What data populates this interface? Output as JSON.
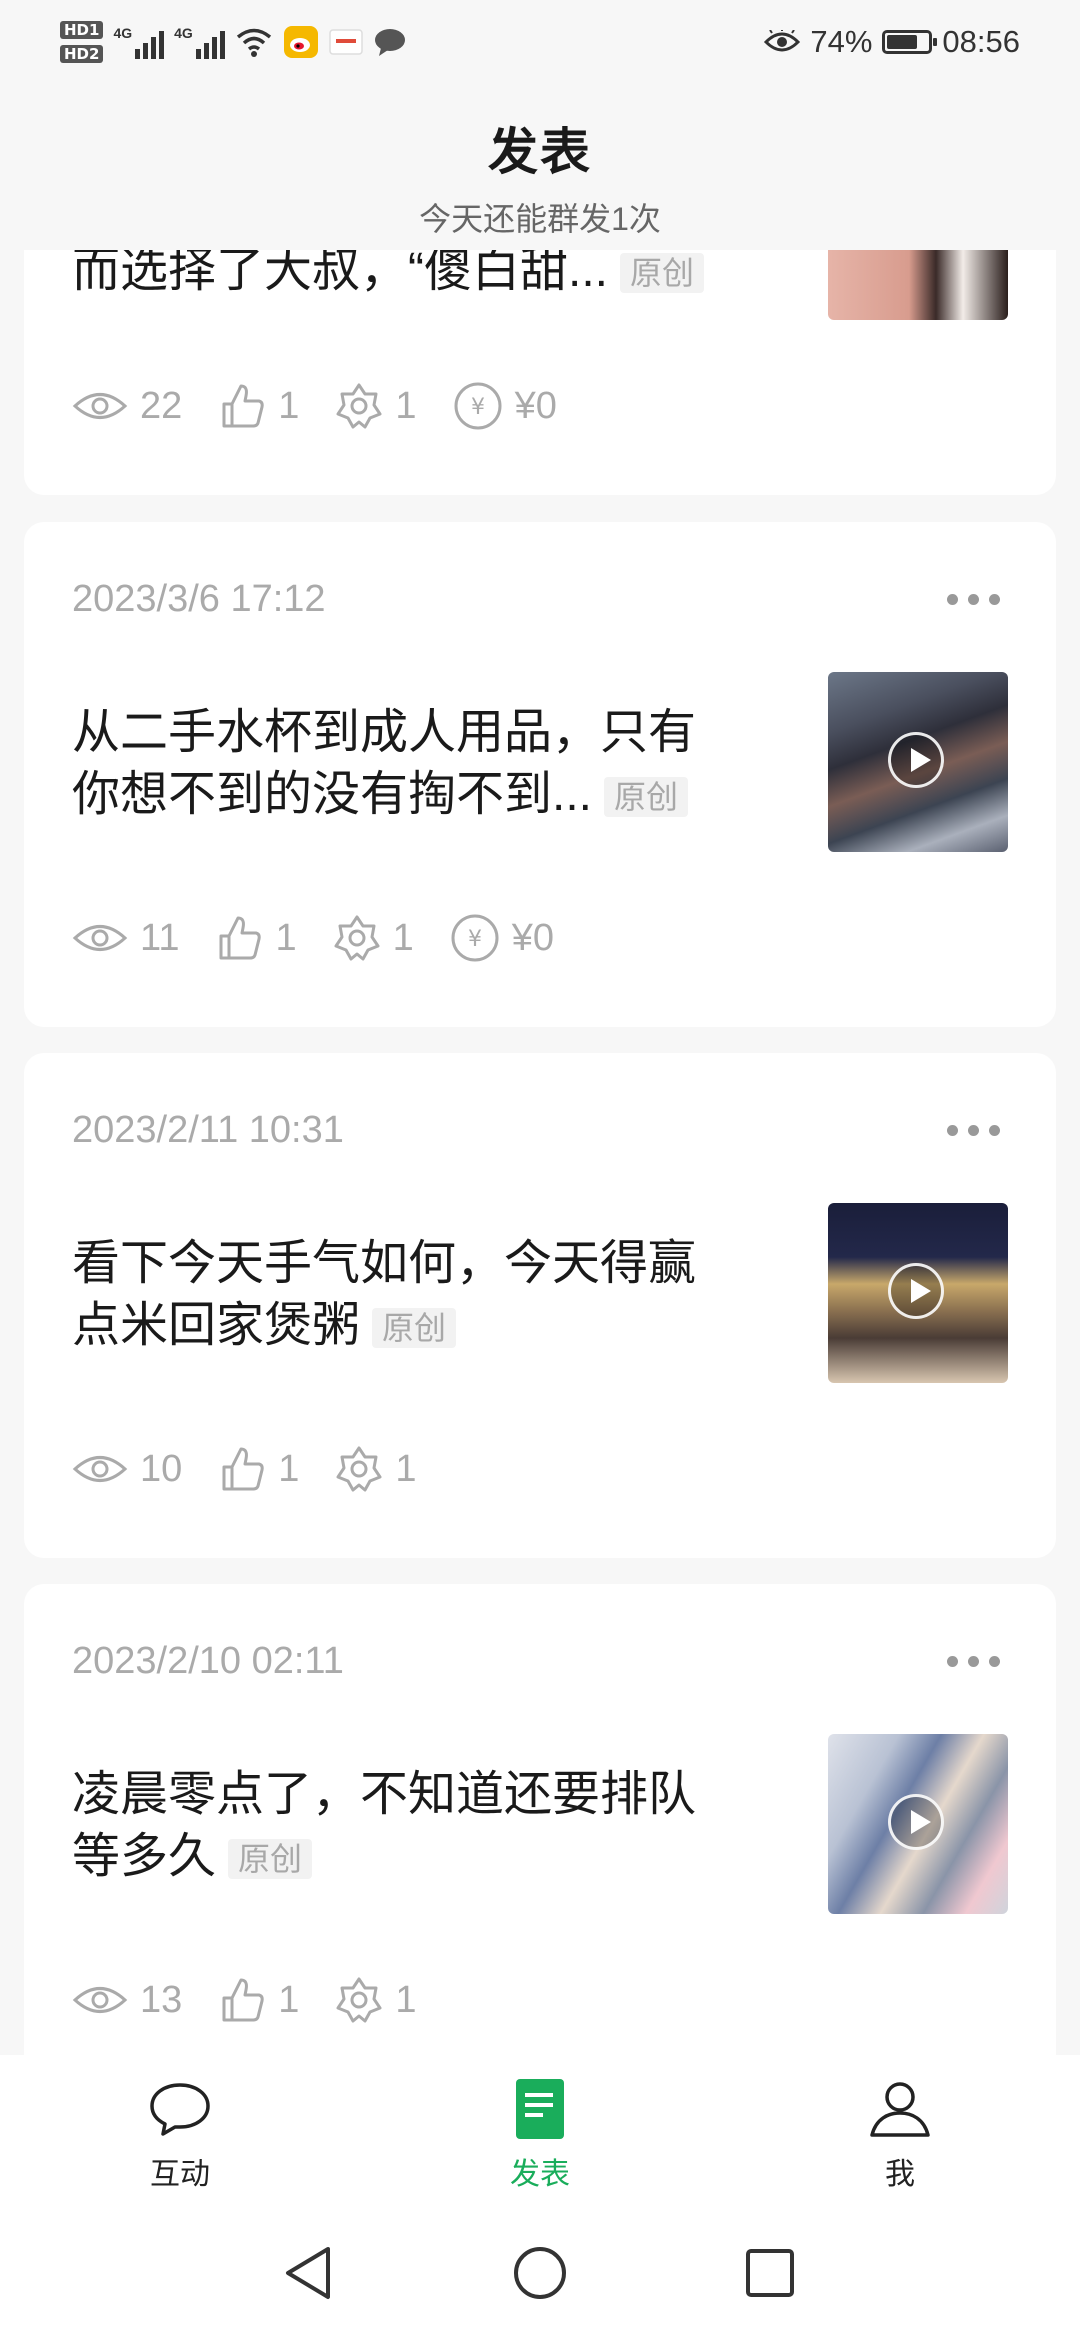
{
  "status_bar": {
    "network_badges": [
      "HD1",
      "HD2"
    ],
    "signal_labels": [
      "4G",
      "4G"
    ],
    "battery_percent_text": "74%",
    "battery_level": 0.74,
    "time": "08:56"
  },
  "header": {
    "title": "发表",
    "subtitle": "今天还能群发1次"
  },
  "articles": [
    {
      "title": "而选择了大叔，“傻白甜...",
      "tag": "原创",
      "stats": {
        "views": "22",
        "likes": "1",
        "shares": "1",
        "reward": "¥0"
      }
    },
    {
      "date": "2023/3/6 17:12",
      "title_line1": "从二手水杯到成人用品，只有",
      "title_line2": "你想不到的没有掏不到...",
      "tag": "原创",
      "stats": {
        "views": "11",
        "likes": "1",
        "shares": "1",
        "reward": "¥0"
      }
    },
    {
      "date": "2023/2/11 10:31",
      "title_line1": "看下今天手气如何，今天得赢",
      "title_line2": "点米回家煲粥",
      "tag": "原创",
      "stats": {
        "views": "10",
        "likes": "1",
        "shares": "1"
      }
    },
    {
      "date": "2023/2/10 02:11",
      "title_line1": "凌晨零点了，不知道还要排队",
      "title_line2": "等多久",
      "tag": "原创",
      "stats": {
        "views": "13",
        "likes": "1",
        "shares": "1"
      }
    }
  ],
  "bottom_nav": [
    {
      "label": "互动",
      "icon": "chat-bubble-icon",
      "active": false
    },
    {
      "label": "发表",
      "icon": "document-icon",
      "active": true
    },
    {
      "label": "我",
      "icon": "person-icon",
      "active": false
    }
  ],
  "colors": {
    "accent": "#1aad5b",
    "muted_text": "#aaaaaa",
    "background": "#f7f7f7"
  }
}
